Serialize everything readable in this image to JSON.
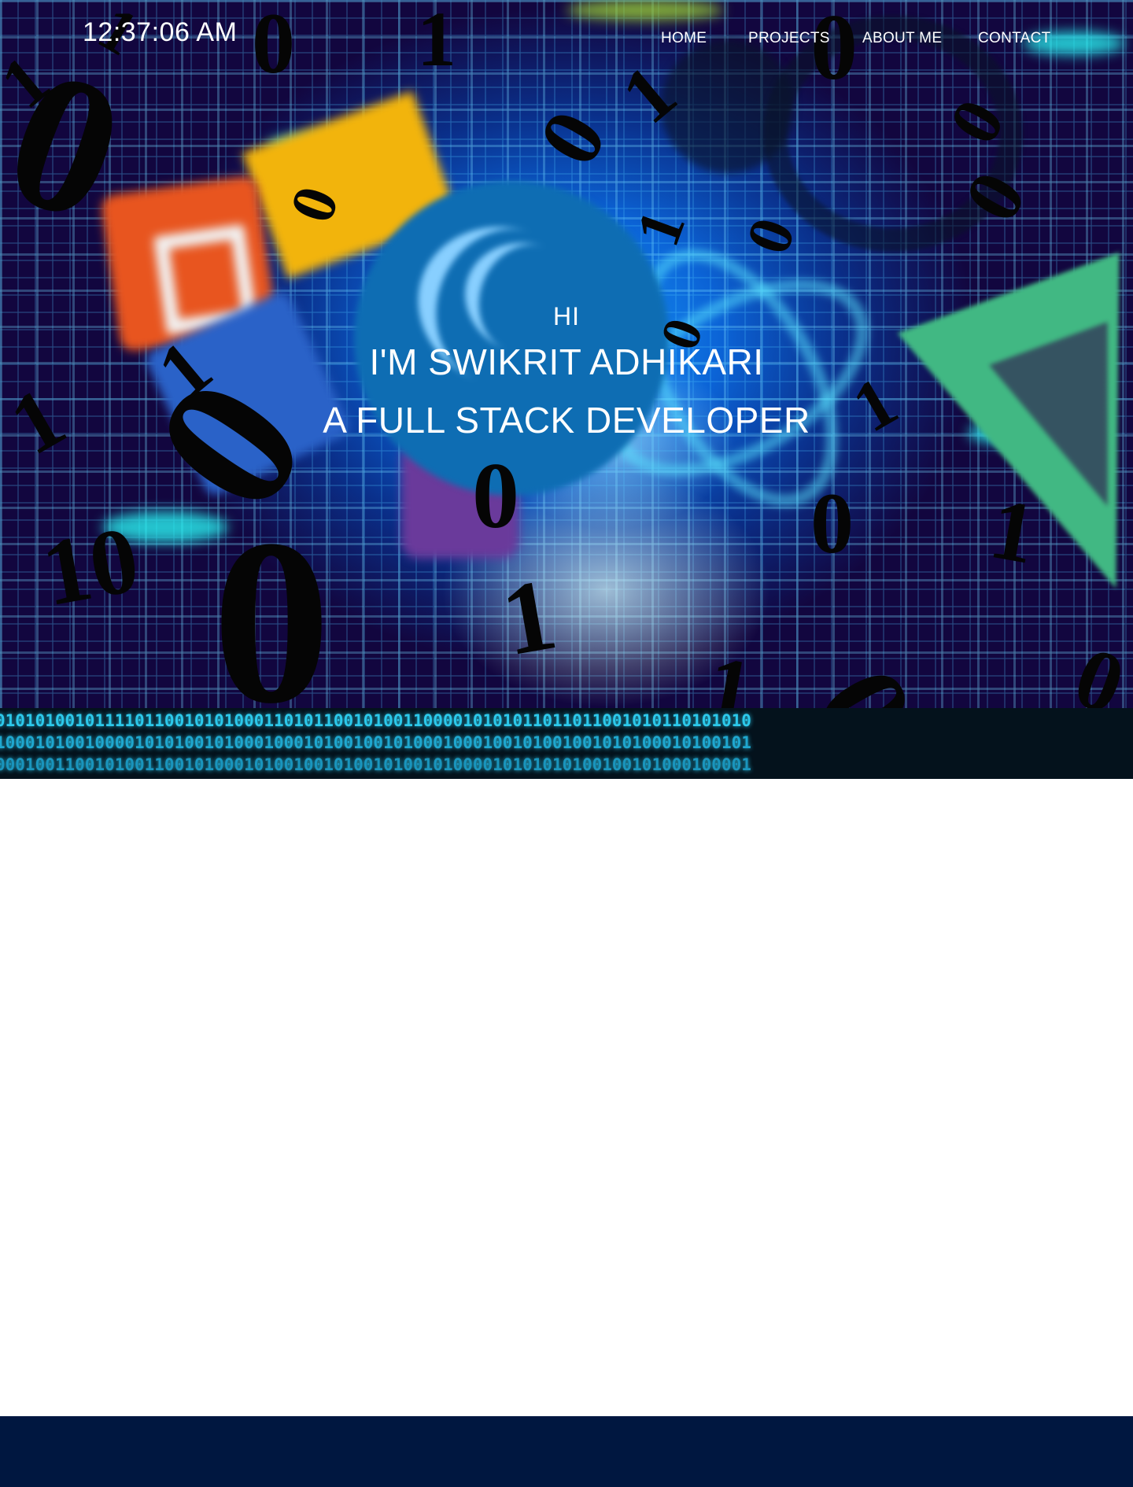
{
  "header": {
    "clock": "12:37:06 AM"
  },
  "nav": {
    "items": [
      {
        "label": "HOME"
      },
      {
        "label": "PROJECTS"
      },
      {
        "label": "ABOUT ME"
      },
      {
        "label": "CONTACT"
      }
    ]
  },
  "hero": {
    "greeting": "HI",
    "name_line": "I'M SWIKRIT ADHIKARI",
    "role_line": "A FULL STACK DEVELOPER"
  },
  "binary_strip": {
    "line1": "0101010010111101100101010001101011001010011000010101011011011001010110101010",
    "line2": "1000101001000010101001010001000101001001010001000100101001001010100010100101",
    "line3": "0001001100101001100101000101001001010010100101000010101010100100101000100001"
  },
  "colors": {
    "hero_accent": "#0b63d6",
    "footer_bg": "#001740",
    "binary_text": "#2cc8ea"
  }
}
